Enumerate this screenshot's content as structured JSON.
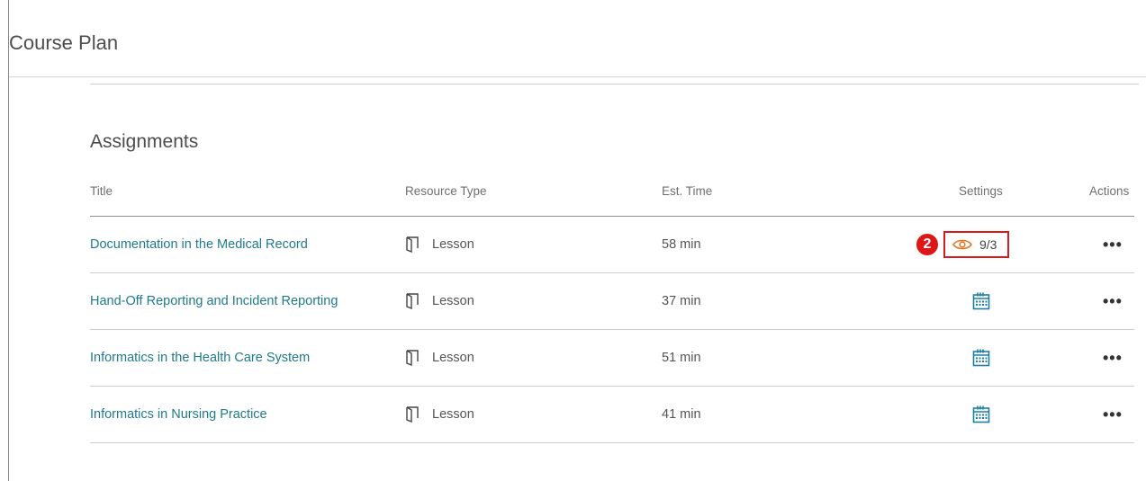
{
  "header": {
    "title": "Course Plan"
  },
  "section": {
    "title": "Assignments"
  },
  "table": {
    "columns": {
      "title": "Title",
      "resource_type": "Resource Type",
      "est_time": "Est. Time",
      "settings": "Settings",
      "actions": "Actions"
    },
    "rows": [
      {
        "title": "Documentation in the Medical Record",
        "resource_type": "Lesson",
        "est_time": "58 min",
        "settings": "visibility",
        "settings_value": "9/3",
        "actions": "•••"
      },
      {
        "title": "Hand-Off Reporting and Incident Reporting",
        "resource_type": "Lesson",
        "est_time": "37 min",
        "settings": "calendar",
        "actions": "•••"
      },
      {
        "title": "Informatics in the Health Care System",
        "resource_type": "Lesson",
        "est_time": "51 min",
        "settings": "calendar",
        "actions": "•••"
      },
      {
        "title": "Informatics in Nursing Practice",
        "resource_type": "Lesson",
        "est_time": "41 min",
        "settings": "calendar",
        "actions": "•••"
      }
    ]
  },
  "callout": {
    "number": "2"
  },
  "icons": {
    "resource": "lesson-book-icon",
    "visibility": "eye-icon",
    "schedule": "calendar-icon"
  },
  "colors": {
    "link": "#1f7a8c",
    "calendar": "#1d7fa6",
    "eye": "#e87722",
    "callout_red": "#e01616"
  }
}
